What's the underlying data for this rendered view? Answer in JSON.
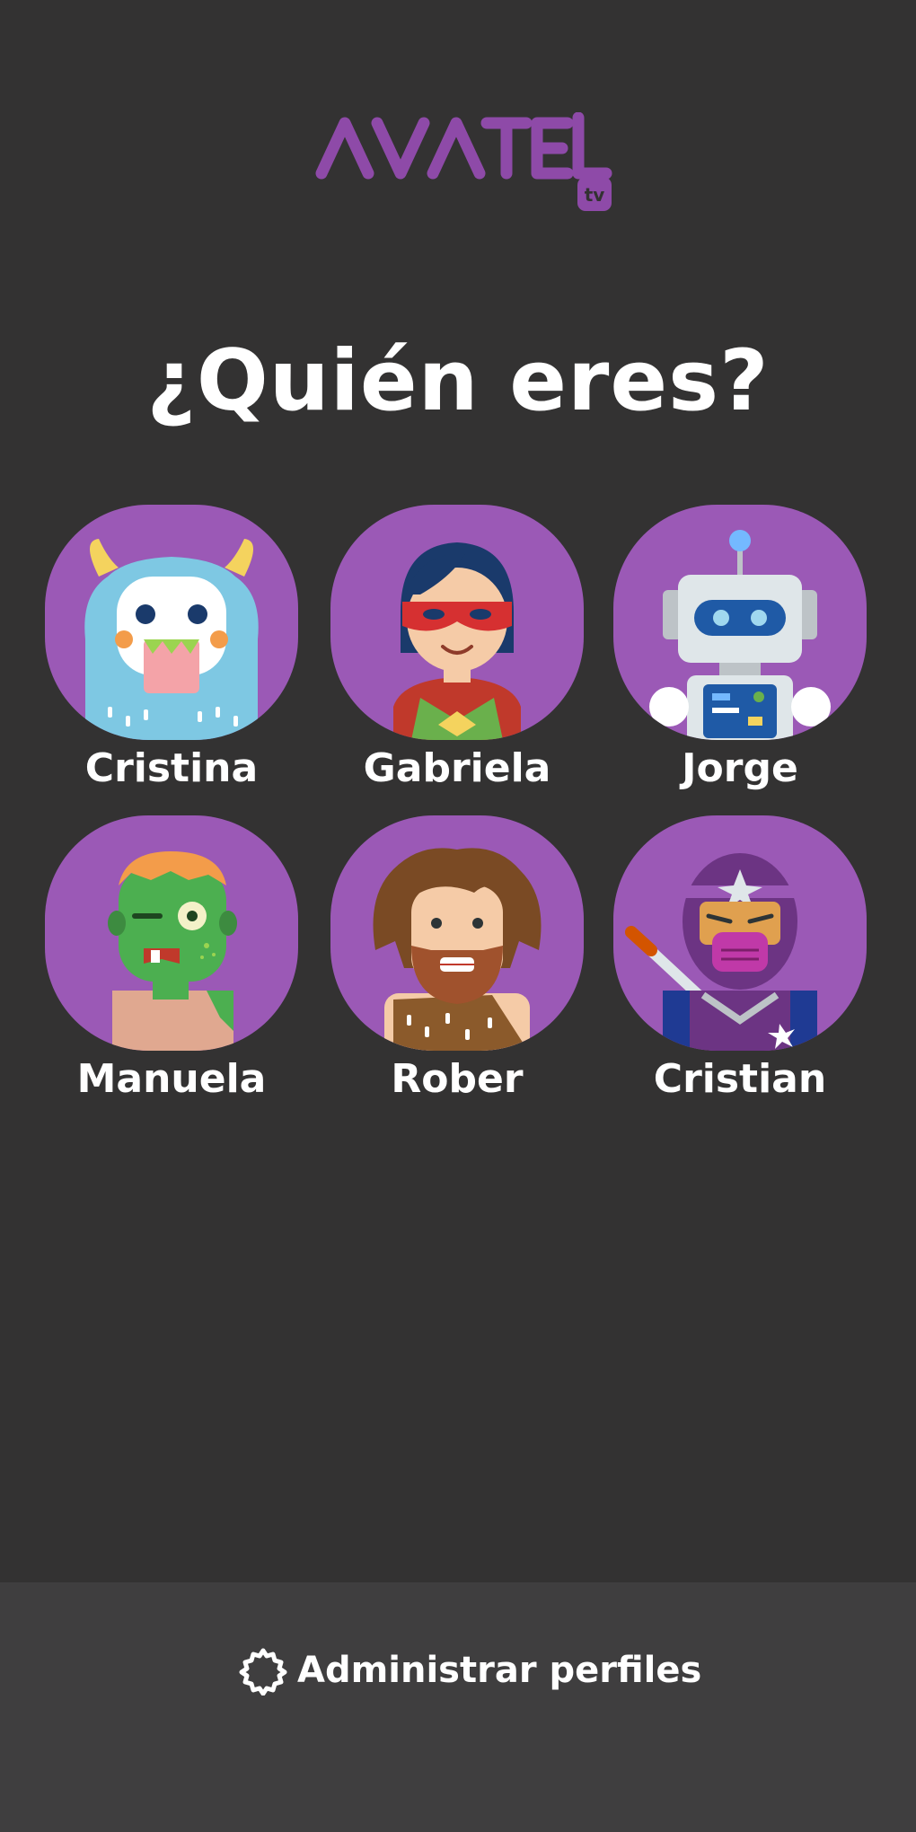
{
  "brand": {
    "logo_text": "AVATEL",
    "logo_sub": "tv",
    "accent_color": "#8e4aa8",
    "avatar_bg": "#9b59b6"
  },
  "heading": "¿Quién eres?",
  "profiles": [
    {
      "name": "Cristina",
      "icon": "yeti-monster-avatar-icon"
    },
    {
      "name": "Gabriela",
      "icon": "superhero-mask-avatar-icon"
    },
    {
      "name": "Jorge",
      "icon": "robot-avatar-icon"
    },
    {
      "name": "Manuela",
      "icon": "zombie-avatar-icon"
    },
    {
      "name": "Rober",
      "icon": "caveman-avatar-icon"
    },
    {
      "name": "Cristian",
      "icon": "ninja-avatar-icon"
    }
  ],
  "footer": {
    "manage_label": "Administrar perfiles",
    "icon": "gear-icon"
  }
}
